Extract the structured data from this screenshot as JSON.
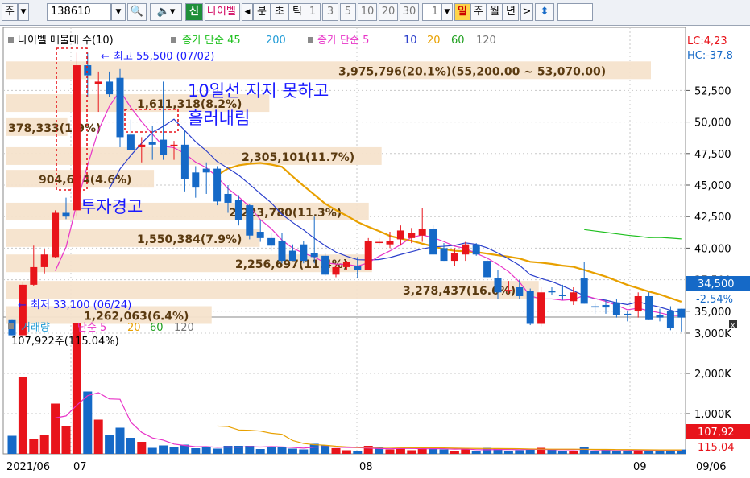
{
  "toolbar": {
    "market_select": "주",
    "stock_code": "138610",
    "stock_name": "나이벨",
    "new_badge": "신",
    "period_units": [
      "분",
      "초",
      "틱"
    ],
    "intervals": [
      "1",
      "3",
      "5",
      "10",
      "20",
      "30"
    ],
    "count_value": "1",
    "timeframes": [
      "일",
      "주",
      "월",
      "년"
    ],
    "selected_timeframe": "일",
    "nav_right": ">",
    "updown_icon": "updown-arrow-icon"
  },
  "colors": {
    "up": "#e8141b",
    "down": "#1569c7",
    "ma5": "#e834c8",
    "ma10": "#2a3ecb",
    "ma20": "#e8a000",
    "ma60": "#20c020",
    "volma5": "#e834c8",
    "volma20": "#e8a000",
    "annotation": "#1a1aff",
    "profile_band": "#f5e3cc"
  },
  "price_panel": {
    "legend": {
      "name": "나이벨 매물대 수(10)",
      "ma_label": "종가 단순 45",
      "ma_label_200": "200",
      "ma2_label": "종가 단순 5",
      "periods": [
        "10",
        "20",
        "60",
        "120"
      ]
    },
    "lc_label": "LC:4,23",
    "hc_label": "HC:-37.8",
    "high_label": "최고 55,500 (07/02)",
    "low_label": "최저 33,100 (06/24)",
    "current_price": "34,500",
    "current_change": "-2.54%",
    "annotations": {
      "warning": "투자경고",
      "line1": "10일선 지지 못하고",
      "line2": "흘러내림"
    }
  },
  "volume_panel": {
    "legend": {
      "name": "거래량",
      "ma_label": "단순 5",
      "periods": [
        "20",
        "60",
        "120"
      ]
    },
    "last_volume": "107,922주(115.04%)",
    "current_volume": "107,92",
    "current_ratio": "115.04"
  },
  "x_axis": {
    "labels": [
      "2021/06",
      "07",
      "08",
      "09",
      "09/06"
    ]
  },
  "chart_data": [
    {
      "type": "candlestick",
      "title": "나이벨 매물대 수(10)",
      "ylim": [
        32500,
        57500
      ],
      "y_ticks": [
        "52,500",
        "50,000",
        "47,500",
        "45,000",
        "42,500",
        "40,000",
        "37,500",
        "35,000"
      ],
      "candles": [
        {
          "o": 34300,
          "h": 34300,
          "l": 33100,
          "c": 33100
        },
        {
          "o": 33100,
          "h": 37300,
          "l": 33100,
          "c": 37100
        },
        {
          "o": 37100,
          "h": 40200,
          "l": 37000,
          "c": 38500
        },
        {
          "o": 38500,
          "h": 39900,
          "l": 38000,
          "c": 39500
        },
        {
          "o": 39300,
          "h": 43000,
          "l": 39200,
          "c": 42800
        },
        {
          "o": 42800,
          "h": 44000,
          "l": 42300,
          "c": 42500
        },
        {
          "o": 43000,
          "h": 55500,
          "l": 42500,
          "c": 54500
        },
        {
          "o": 54500,
          "h": 55500,
          "l": 52000,
          "c": 53700
        },
        {
          "o": 53000,
          "h": 54000,
          "l": 50800,
          "c": 53200
        },
        {
          "o": 53200,
          "h": 54000,
          "l": 52000,
          "c": 52200
        },
        {
          "o": 53500,
          "h": 54200,
          "l": 48000,
          "c": 48800
        },
        {
          "o": 49000,
          "h": 50200,
          "l": 47800,
          "c": 47800
        },
        {
          "o": 48000,
          "h": 48800,
          "l": 46800,
          "c": 48200
        },
        {
          "o": 48400,
          "h": 49700,
          "l": 47000,
          "c": 48200
        },
        {
          "o": 48600,
          "h": 53200,
          "l": 47000,
          "c": 47400
        },
        {
          "o": 48200,
          "h": 48500,
          "l": 47000,
          "c": 48200
        },
        {
          "o": 48200,
          "h": 49300,
          "l": 44500,
          "c": 45500
        },
        {
          "o": 46000,
          "h": 46500,
          "l": 44000,
          "c": 44800
        },
        {
          "o": 46300,
          "h": 46800,
          "l": 44300,
          "c": 46000
        },
        {
          "o": 46300,
          "h": 46500,
          "l": 43400,
          "c": 43700
        },
        {
          "o": 44300,
          "h": 45000,
          "l": 42800,
          "c": 43600
        },
        {
          "o": 43800,
          "h": 44200,
          "l": 41800,
          "c": 42200
        },
        {
          "o": 43400,
          "h": 43500,
          "l": 40700,
          "c": 41000
        },
        {
          "o": 41300,
          "h": 42200,
          "l": 40500,
          "c": 40800
        },
        {
          "o": 40800,
          "h": 41200,
          "l": 39800,
          "c": 40200
        },
        {
          "o": 40600,
          "h": 41200,
          "l": 38800,
          "c": 39000
        },
        {
          "o": 39800,
          "h": 40300,
          "l": 39000,
          "c": 39000
        },
        {
          "o": 40300,
          "h": 40600,
          "l": 38800,
          "c": 39000
        },
        {
          "o": 39600,
          "h": 42500,
          "l": 38800,
          "c": 39300
        },
        {
          "o": 39400,
          "h": 39600,
          "l": 37800,
          "c": 37900
        },
        {
          "o": 37900,
          "h": 38700,
          "l": 37700,
          "c": 38500
        },
        {
          "o": 38500,
          "h": 39000,
          "l": 38300,
          "c": 38900
        },
        {
          "o": 38600,
          "h": 39300,
          "l": 37600,
          "c": 38300
        },
        {
          "o": 38300,
          "h": 40800,
          "l": 38300,
          "c": 40600
        },
        {
          "o": 40500,
          "h": 40800,
          "l": 40200,
          "c": 40500
        },
        {
          "o": 40300,
          "h": 41300,
          "l": 40000,
          "c": 40600
        },
        {
          "o": 40700,
          "h": 41800,
          "l": 40200,
          "c": 41400
        },
        {
          "o": 40800,
          "h": 41600,
          "l": 40400,
          "c": 41200
        },
        {
          "o": 41000,
          "h": 43200,
          "l": 40500,
          "c": 41500
        },
        {
          "o": 41500,
          "h": 41800,
          "l": 39500,
          "c": 39500
        },
        {
          "o": 40000,
          "h": 40400,
          "l": 39000,
          "c": 39000
        },
        {
          "o": 39000,
          "h": 40000,
          "l": 38600,
          "c": 39600
        },
        {
          "o": 39500,
          "h": 40500,
          "l": 39000,
          "c": 40300
        },
        {
          "o": 40300,
          "h": 40400,
          "l": 39400,
          "c": 39500
        },
        {
          "o": 39000,
          "h": 39300,
          "l": 37600,
          "c": 37700
        },
        {
          "o": 37600,
          "h": 38300,
          "l": 36000,
          "c": 36500
        },
        {
          "o": 36700,
          "h": 37400,
          "l": 36400,
          "c": 36700
        },
        {
          "o": 36900,
          "h": 37500,
          "l": 36000,
          "c": 36200
        },
        {
          "o": 36600,
          "h": 36800,
          "l": 33900,
          "c": 34000
        },
        {
          "o": 34000,
          "h": 36900,
          "l": 33800,
          "c": 36500
        },
        {
          "o": 36600,
          "h": 36900,
          "l": 36300,
          "c": 36500
        },
        {
          "o": 36300,
          "h": 37100,
          "l": 35900,
          "c": 36200
        },
        {
          "o": 35800,
          "h": 36900,
          "l": 35500,
          "c": 36500
        },
        {
          "o": 37600,
          "h": 38900,
          "l": 35600,
          "c": 35600
        },
        {
          "o": 35400,
          "h": 35600,
          "l": 34800,
          "c": 35300
        },
        {
          "o": 35500,
          "h": 35900,
          "l": 34800,
          "c": 35300
        },
        {
          "o": 35700,
          "h": 36000,
          "l": 34500,
          "c": 34700
        },
        {
          "o": 34800,
          "h": 35000,
          "l": 34200,
          "c": 34700
        },
        {
          "o": 35000,
          "h": 36500,
          "l": 34500,
          "c": 36200
        },
        {
          "o": 36200,
          "h": 36500,
          "l": 34300,
          "c": 34300
        },
        {
          "o": 34700,
          "h": 35200,
          "l": 34200,
          "c": 34500
        },
        {
          "o": 35000,
          "h": 35400,
          "l": 33500,
          "c": 33700
        },
        {
          "o": 35200,
          "h": 35200,
          "l": 33400,
          "c": 34500
        }
      ],
      "volume_profile": [
        {
          "label": "3,975,796(20.1%)(55,200.00 ~ 53,070.00)",
          "price": 54100,
          "share": 20.1
        },
        {
          "label": "1,611,318(8.2%)",
          "price": 51500,
          "share": 8.2
        },
        {
          "label": "378,333(1.9%)",
          "price": 49600,
          "share": 1.9
        },
        {
          "label": "2,305,101(11.7%)",
          "price": 47300,
          "share": 11.7
        },
        {
          "label": "904,674(4.6%)",
          "price": 45500,
          "share": 4.6
        },
        {
          "label": "2,223,780(11.3%)",
          "price": 42900,
          "share": 11.3
        },
        {
          "label": "1,550,384(7.9%)",
          "price": 40800,
          "share": 7.9
        },
        {
          "label": "2,256,697(11.4%)",
          "price": 38800,
          "share": 11.4
        },
        {
          "label": "3,278,437(16.6%)",
          "price": 36700,
          "share": 16.6
        },
        {
          "label": "1,262,063(6.4%)",
          "price": 34700,
          "share": 6.4
        }
      ]
    },
    {
      "type": "bar",
      "title": "거래량",
      "ylim": [
        0,
        3400000
      ],
      "y_ticks": [
        "3,000K",
        "2,000K",
        "1,000K"
      ],
      "values": [
        450000,
        1900000,
        380000,
        480000,
        1250000,
        700000,
        3250000,
        1550000,
        850000,
        480000,
        650000,
        400000,
        300000,
        150000,
        210000,
        160000,
        230000,
        140000,
        160000,
        130000,
        200000,
        200000,
        200000,
        120000,
        180000,
        170000,
        130000,
        110000,
        250000,
        210000,
        140000,
        90000,
        80000,
        200000,
        150000,
        110000,
        130000,
        90000,
        150000,
        160000,
        110000,
        80000,
        110000,
        60000,
        150000,
        140000,
        80000,
        90000,
        100000,
        150000,
        100000,
        80000,
        80000,
        160000,
        80000,
        90000,
        70000,
        70000,
        110000,
        80000,
        60000,
        100000,
        107922
      ],
      "up_flags": [
        false,
        true,
        true,
        true,
        true,
        true,
        true,
        false,
        true,
        false,
        false,
        false,
        true,
        false,
        false,
        false,
        false,
        false,
        false,
        false,
        false,
        false,
        false,
        false,
        false,
        false,
        false,
        false,
        false,
        false,
        true,
        true,
        false,
        true,
        false,
        true,
        true,
        true,
        true,
        false,
        false,
        true,
        true,
        false,
        false,
        false,
        false,
        false,
        false,
        true,
        false,
        false,
        true,
        false,
        false,
        false,
        false,
        false,
        true,
        false,
        false,
        false,
        false
      ]
    }
  ]
}
